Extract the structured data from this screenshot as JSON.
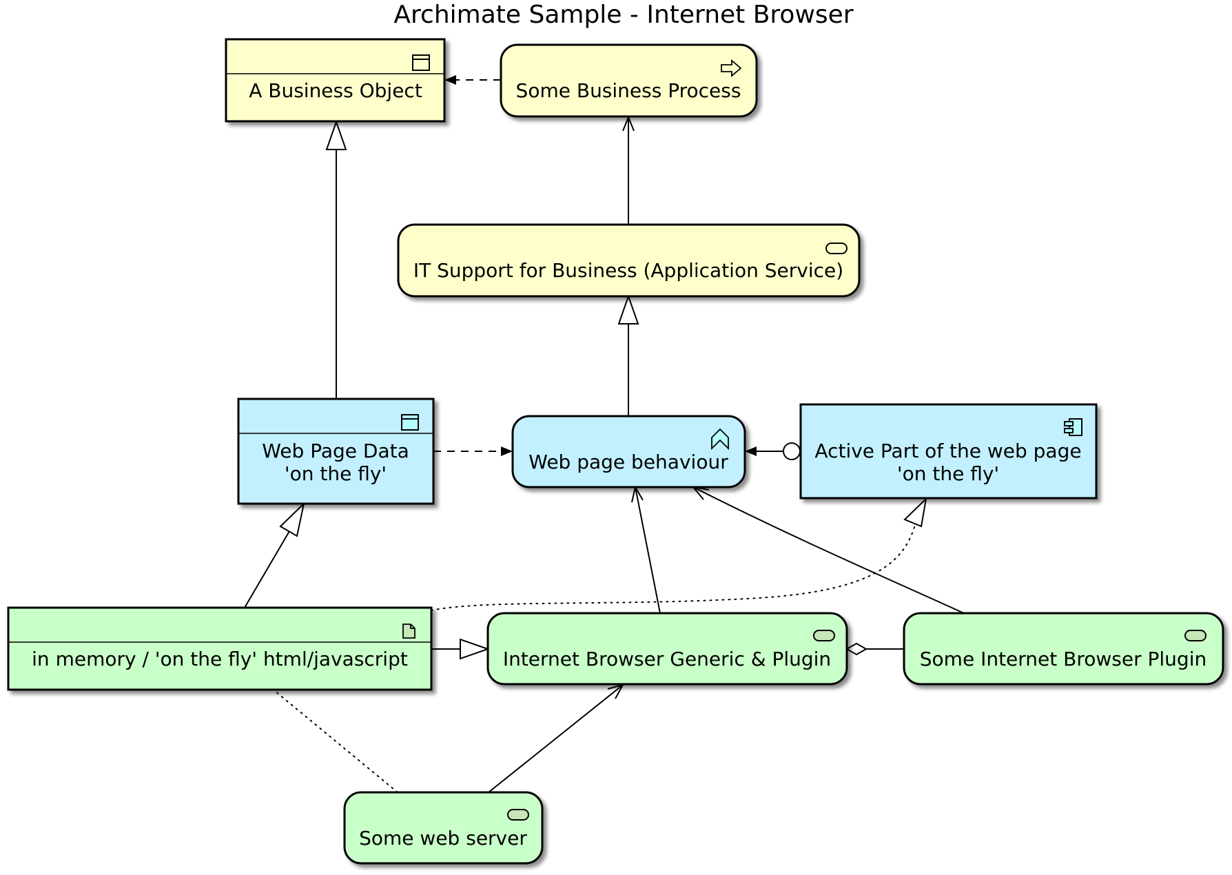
{
  "title": "Archimate Sample - Internet Browser",
  "colors": {
    "business": "#FFFFCC",
    "application": "#C2F0FF",
    "technology": "#C9FFC9",
    "icon_business": "#FFFFCC",
    "icon_application": "#B5FFFF",
    "icon_technology": "#C8E6B8",
    "stroke": "#000000"
  },
  "nodes": {
    "business_object": {
      "label": "A Business Object",
      "icon": "business-object-icon",
      "layer": "business"
    },
    "business_process": {
      "label": "Some Business Process",
      "icon": "process-arrow-icon",
      "layer": "business"
    },
    "it_support": {
      "label": "IT Support for Business (Application Service)",
      "icon": "service-icon",
      "layer": "business"
    },
    "web_page_data": {
      "label_line1": "Web Page Data",
      "label_line2": "'on the fly'",
      "icon": "data-object-icon",
      "layer": "application"
    },
    "web_page_behaviour": {
      "label": "Web page behaviour",
      "icon": "function-chevron-icon",
      "layer": "application"
    },
    "active_part": {
      "label_line1": "Active Part of the web page",
      "label_line2": "'on the fly'",
      "icon": "component-icon",
      "layer": "application"
    },
    "in_memory": {
      "label": "in memory / 'on the fly' html/javascript",
      "icon": "artifact-icon",
      "layer": "technology"
    },
    "browser_generic": {
      "label": "Internet Browser Generic & Plugin",
      "icon": "service-icon",
      "layer": "technology"
    },
    "browser_plugin": {
      "label": "Some Internet Browser Plugin",
      "icon": "service-icon",
      "layer": "technology"
    },
    "web_server": {
      "label": "Some web server",
      "icon": "service-icon",
      "layer": "technology"
    }
  },
  "edges": [
    {
      "from": "business_process",
      "to": "business_object",
      "type": "access",
      "style": "dashed",
      "head": "filled-arrow"
    },
    {
      "from": "it_support",
      "to": "business_process",
      "type": "serving",
      "style": "solid",
      "head": "open-arrow"
    },
    {
      "from": "web_page_data",
      "to": "business_object",
      "type": "realization",
      "style": "solid",
      "head": "hollow-triangle"
    },
    {
      "from": "web_page_behaviour",
      "to": "it_support",
      "type": "realization",
      "style": "solid",
      "head": "hollow-triangle"
    },
    {
      "from": "web_page_data",
      "to": "web_page_behaviour",
      "type": "access",
      "style": "dashed",
      "head": "filled-arrow"
    },
    {
      "from": "active_part",
      "to": "web_page_behaviour",
      "type": "assignment",
      "style": "solid",
      "head": "filled-arrow-circle-tail"
    },
    {
      "from": "in_memory",
      "to": "web_page_data",
      "type": "realization",
      "style": "solid",
      "head": "hollow-triangle"
    },
    {
      "from": "in_memory",
      "to": "active_part",
      "type": "realization",
      "style": "dotted",
      "head": "hollow-triangle"
    },
    {
      "from": "in_memory",
      "to": "browser_generic",
      "type": "specialization",
      "style": "solid",
      "head": "hollow-triangle"
    },
    {
      "from": "browser_generic",
      "to": "web_page_behaviour",
      "type": "serving",
      "style": "solid",
      "head": "open-arrow"
    },
    {
      "from": "browser_plugin",
      "to": "web_page_behaviour",
      "type": "serving",
      "style": "solid",
      "head": "open-arrow"
    },
    {
      "from": "browser_plugin",
      "to": "browser_generic",
      "type": "aggregation",
      "style": "solid",
      "head": "hollow-diamond"
    },
    {
      "from": "web_server",
      "to": "browser_generic",
      "type": "serving",
      "style": "solid",
      "head": "open-arrow"
    },
    {
      "from": "web_server",
      "to": "in_memory",
      "type": "association",
      "style": "dotted",
      "head": "none"
    }
  ]
}
